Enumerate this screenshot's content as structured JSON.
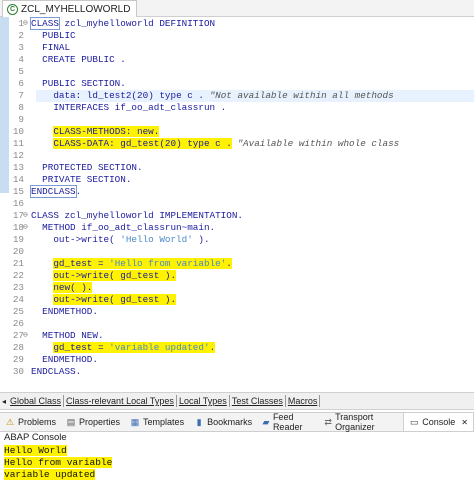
{
  "editor_tab": {
    "title": "ZCL_MYHELLOWORLD"
  },
  "code_lines": [
    {
      "ln": "1",
      "fold": "⊖",
      "segs": [
        {
          "t": "CLASS",
          "c": "boxed"
        },
        {
          "t": " zcl_myhelloworld DEFINITION"
        }
      ]
    },
    {
      "ln": "2",
      "segs": [
        {
          "t": "  PUBLIC"
        }
      ]
    },
    {
      "ln": "3",
      "segs": [
        {
          "t": "  FINAL"
        }
      ]
    },
    {
      "ln": "4",
      "segs": [
        {
          "t": "  CREATE PUBLIC ."
        }
      ]
    },
    {
      "ln": "5",
      "segs": [
        {
          "t": ""
        }
      ]
    },
    {
      "ln": "6",
      "segs": [
        {
          "t": "  PUBLIC SECTION."
        }
      ]
    },
    {
      "ln": "7",
      "hl": true,
      "segs": [
        {
          "t": "    data: ld_test2("
        },
        {
          "t": "20",
          "c": "num"
        },
        {
          "t": ") type c . "
        },
        {
          "t": "\"Not available within all methods",
          "c": "cmt"
        }
      ]
    },
    {
      "ln": "8",
      "segs": [
        {
          "t": "    INTERFACES if_oo_adt_classrun ."
        }
      ]
    },
    {
      "ln": "9",
      "segs": [
        {
          "t": ""
        }
      ]
    },
    {
      "ln": "10",
      "segs": [
        {
          "t": "    "
        },
        {
          "t": "CLASS-METHODS: new.",
          "c": "y"
        }
      ]
    },
    {
      "ln": "11",
      "segs": [
        {
          "t": "    "
        },
        {
          "t": "CLASS-DATA: gd_test(20) type c .",
          "c": "y"
        },
        {
          "t": " "
        },
        {
          "t": "\"Available within whole class",
          "c": "cmt"
        }
      ]
    },
    {
      "ln": "12",
      "segs": [
        {
          "t": ""
        }
      ]
    },
    {
      "ln": "13",
      "segs": [
        {
          "t": "  PROTECTED SECTION."
        }
      ]
    },
    {
      "ln": "14",
      "segs": [
        {
          "t": "  PRIVATE SECTION."
        }
      ]
    },
    {
      "ln": "15",
      "segs": [
        {
          "t": "ENDCLASS",
          "c": "boxed"
        },
        {
          "t": "."
        }
      ]
    },
    {
      "ln": "16",
      "segs": [
        {
          "t": ""
        }
      ]
    },
    {
      "ln": "17",
      "fold": "⊖",
      "segs": [
        {
          "t": "CLASS zcl_myhelloworld IMPLEMENTATION."
        }
      ]
    },
    {
      "ln": "18",
      "fold": "⊖",
      "segs": [
        {
          "t": "  METHOD if_oo_adt_classrun~main."
        }
      ]
    },
    {
      "ln": "19",
      "segs": [
        {
          "t": "    out->write( "
        },
        {
          "t": "'Hello World'",
          "c": "str"
        },
        {
          "t": " )."
        }
      ]
    },
    {
      "ln": "20",
      "segs": [
        {
          "t": ""
        }
      ]
    },
    {
      "ln": "21",
      "segs": [
        {
          "t": "    "
        },
        {
          "t": "gd_test = ",
          "c": "y"
        },
        {
          "t": "'Hello from variable'",
          "c": "y str"
        },
        {
          "t": ".",
          "c": "y"
        }
      ]
    },
    {
      "ln": "22",
      "segs": [
        {
          "t": "    "
        },
        {
          "t": "out->write( gd_test ).",
          "c": "y"
        }
      ]
    },
    {
      "ln": "23",
      "segs": [
        {
          "t": "    "
        },
        {
          "t": "new( ).",
          "c": "y"
        }
      ]
    },
    {
      "ln": "24",
      "segs": [
        {
          "t": "    "
        },
        {
          "t": "out->write( gd_test ).",
          "c": "y"
        }
      ]
    },
    {
      "ln": "25",
      "segs": [
        {
          "t": "  ENDMETHOD."
        }
      ]
    },
    {
      "ln": "26",
      "segs": [
        {
          "t": ""
        }
      ]
    },
    {
      "ln": "27",
      "fold": "⊖",
      "segs": [
        {
          "t": "  METHOD NEW."
        }
      ]
    },
    {
      "ln": "28",
      "segs": [
        {
          "t": "    "
        },
        {
          "t": "gd_test = ",
          "c": "y"
        },
        {
          "t": "'variable updated'",
          "c": "y str"
        },
        {
          "t": ".",
          "c": "y"
        }
      ]
    },
    {
      "ln": "29",
      "segs": [
        {
          "t": "  ENDMETHOD."
        }
      ]
    },
    {
      "ln": "30",
      "segs": [
        {
          "t": "ENDCLASS."
        }
      ]
    }
  ],
  "view_tabs": [
    "Global Class",
    "Class-relevant Local Types",
    "Local Types",
    "Test Classes",
    "Macros"
  ],
  "bottom_tabs": [
    {
      "label": "Problems",
      "icon": "problems-icon",
      "glyph": "⚠",
      "color": "#c08a00"
    },
    {
      "label": "Properties",
      "icon": "properties-icon",
      "glyph": "▤",
      "color": "#555555"
    },
    {
      "label": "Templates",
      "icon": "templates-icon",
      "glyph": "▦",
      "color": "#3b6db3"
    },
    {
      "label": "Bookmarks",
      "icon": "bookmarks-icon",
      "glyph": "▮",
      "color": "#3b6db3"
    },
    {
      "label": "Feed Reader",
      "icon": "feed-reader-icon",
      "glyph": "▰",
      "color": "#3b6db3"
    },
    {
      "label": "Transport Organizer",
      "icon": "transport-organizer-icon",
      "glyph": "⇄",
      "color": "#6a6a6a"
    },
    {
      "label": "Console",
      "icon": "console-icon",
      "glyph": "▭",
      "color": "#3b3b3b",
      "active": true
    }
  ],
  "console": {
    "title": "ABAP Console",
    "lines": [
      "Hello World",
      "Hello from variable",
      "variable updated"
    ],
    "highlight_color": "#fff200"
  },
  "colors": {
    "keyword": "#1c1c9e",
    "string": "#4a8ac9",
    "highlight": "#fff200",
    "line_highlight": "#e8f2fe"
  }
}
